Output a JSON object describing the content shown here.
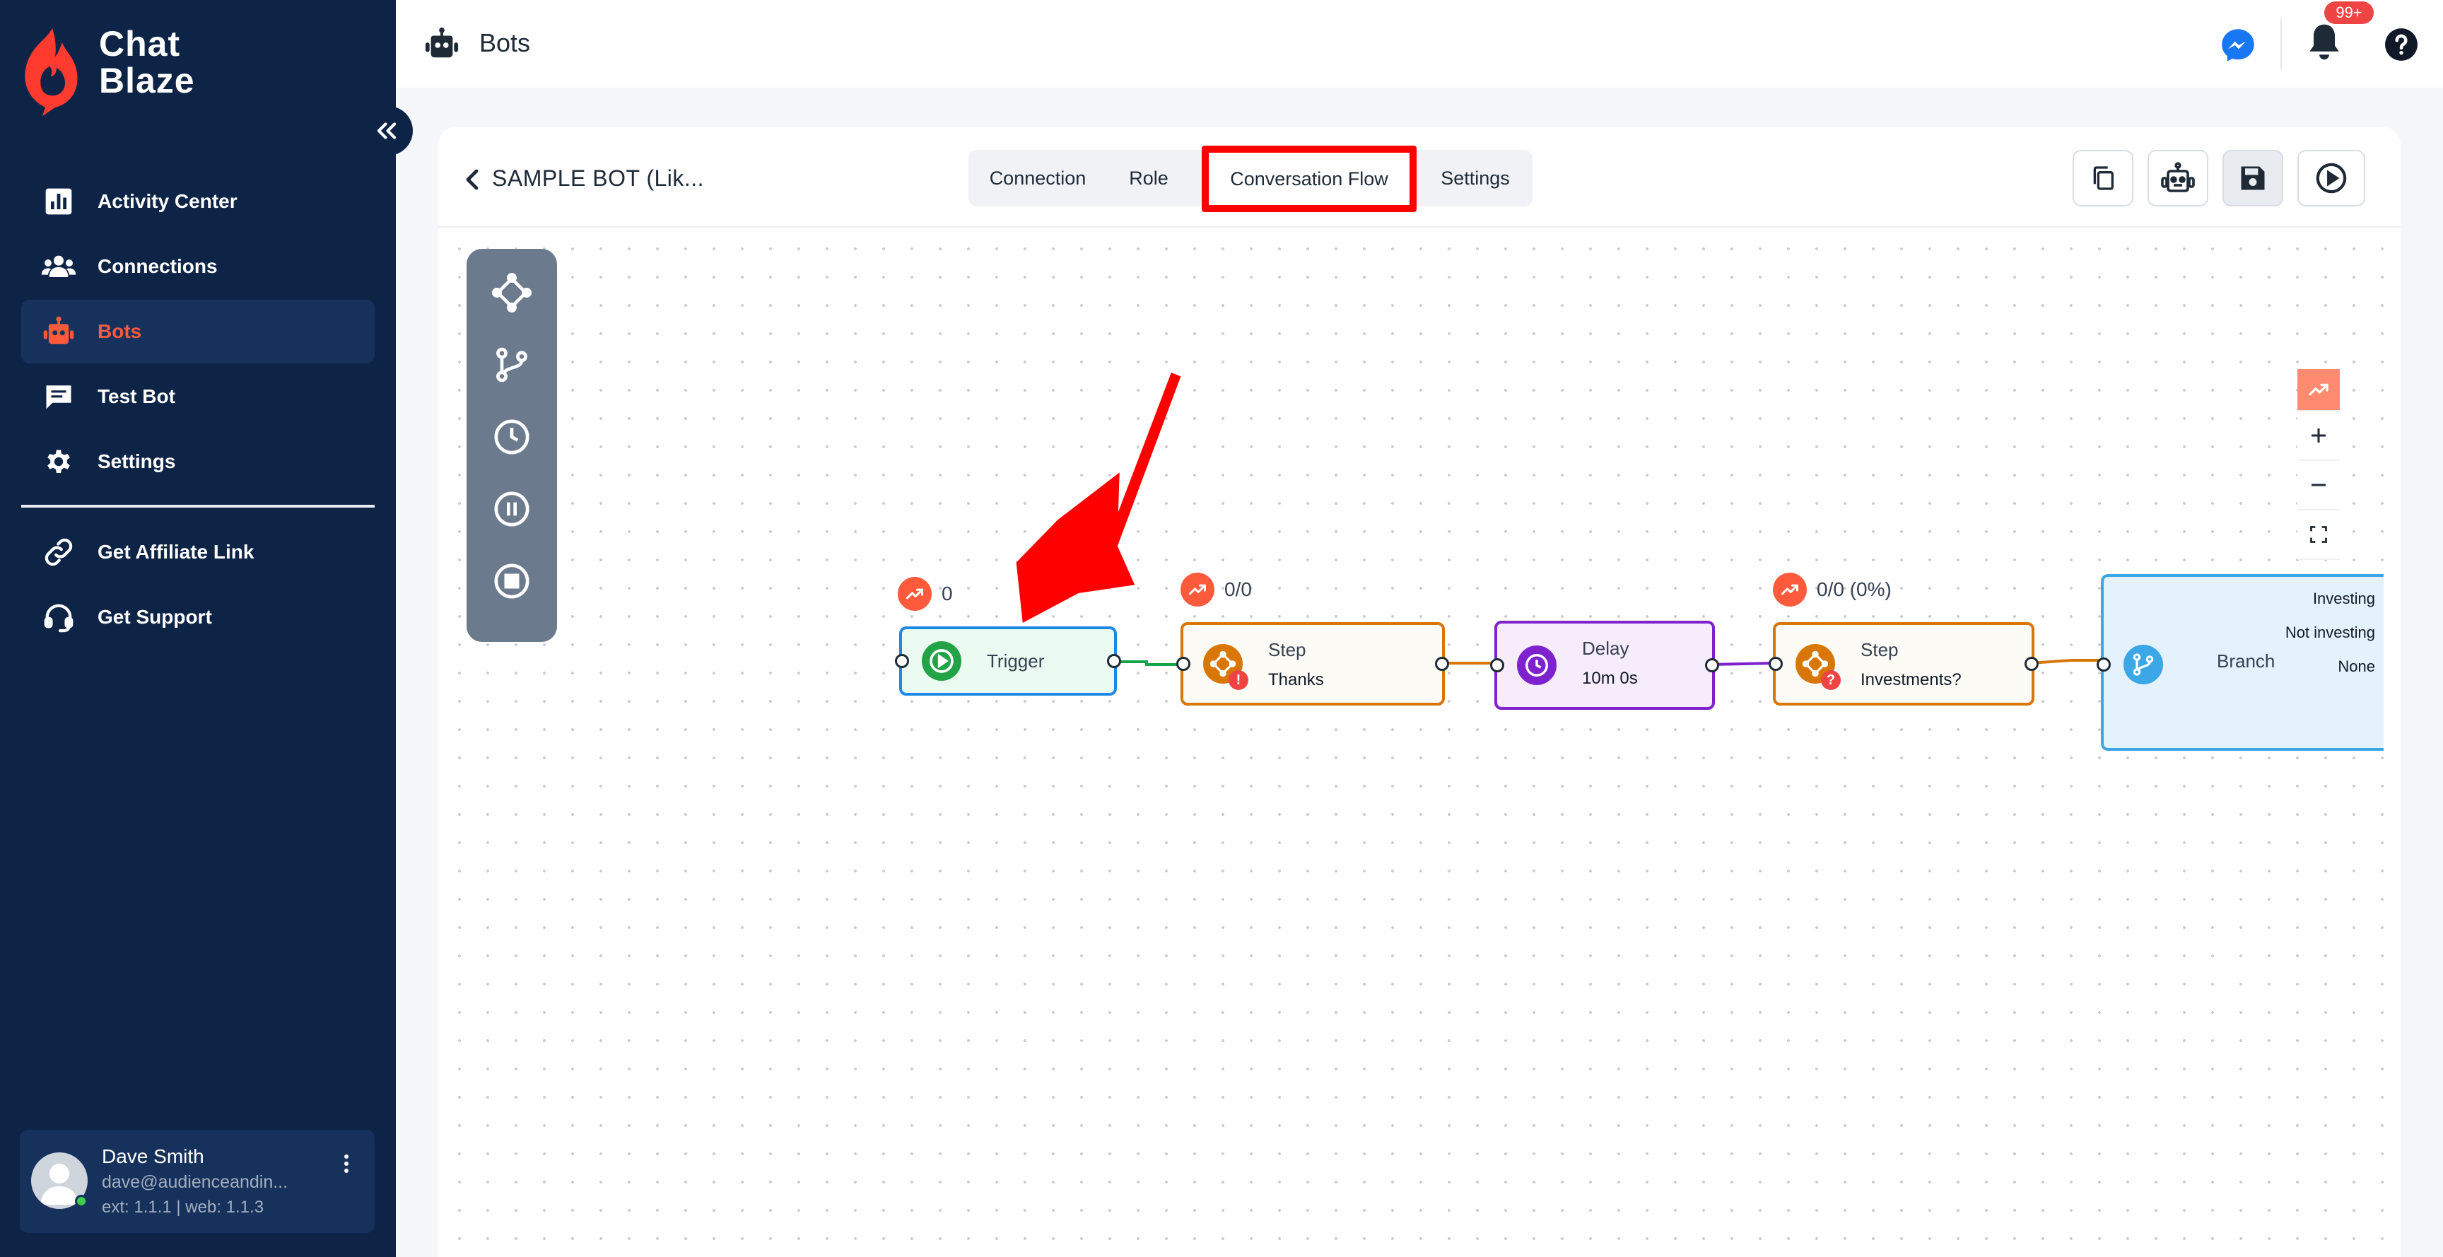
{
  "app": {
    "logo_line1": "Chat",
    "logo_line2": "Blaze",
    "brand_color": "#ff5a3c",
    "sidebar_color": "#0e2447"
  },
  "sidebar": {
    "items": [
      {
        "label": "Activity Center",
        "icon": "bar-chart-icon"
      },
      {
        "label": "Connections",
        "icon": "users-icon"
      },
      {
        "label": "Bots",
        "icon": "robot-icon",
        "active": true
      },
      {
        "label": "Test Bot",
        "icon": "chat-icon"
      },
      {
        "label": "Settings",
        "icon": "gear-icon"
      }
    ],
    "secondary": [
      {
        "label": "Get Affiliate Link",
        "icon": "link-icon"
      },
      {
        "label": "Get Support",
        "icon": "headset-icon"
      }
    ],
    "user": {
      "name": "Dave Smith",
      "email": "dave@audienceandin...",
      "version": "ext: 1.1.1 | web: 1.1.3"
    }
  },
  "topbar": {
    "title": "Bots",
    "notifications_badge": "99+"
  },
  "editor": {
    "bot_name": "SAMPLE BOT (Lik...",
    "tabs": [
      "Connection",
      "Role",
      "Conversation Flow",
      "Settings"
    ],
    "active_tab": "Conversation Flow"
  },
  "flow": {
    "trigger": {
      "label": "Trigger",
      "stat": "0"
    },
    "step1": {
      "title": "Step",
      "name": "Thanks",
      "stat": "0/0"
    },
    "delay": {
      "title": "Delay",
      "value": "10m 0s"
    },
    "step2": {
      "title": "Step",
      "name": "Investments?",
      "stat": "0/0 (0%)"
    },
    "branch": {
      "title": "Branch",
      "options": [
        "Investing",
        "Not investing",
        "None"
      ]
    }
  }
}
